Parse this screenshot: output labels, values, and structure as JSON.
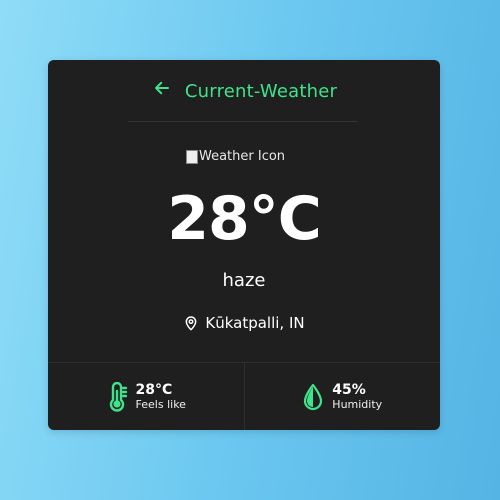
{
  "header": {
    "title": "Current-Weather"
  },
  "weather": {
    "icon_alt": "Weather Icon",
    "temperature": "28°C",
    "description": "haze",
    "location": "Kūkatpalli, IN"
  },
  "stats": {
    "feels_like": {
      "value": "28°C",
      "label": "Feels like"
    },
    "humidity": {
      "value": "45%",
      "label": "Humidity"
    }
  },
  "colors": {
    "accent": "#3ee38c",
    "card": "#1f1f1f"
  }
}
